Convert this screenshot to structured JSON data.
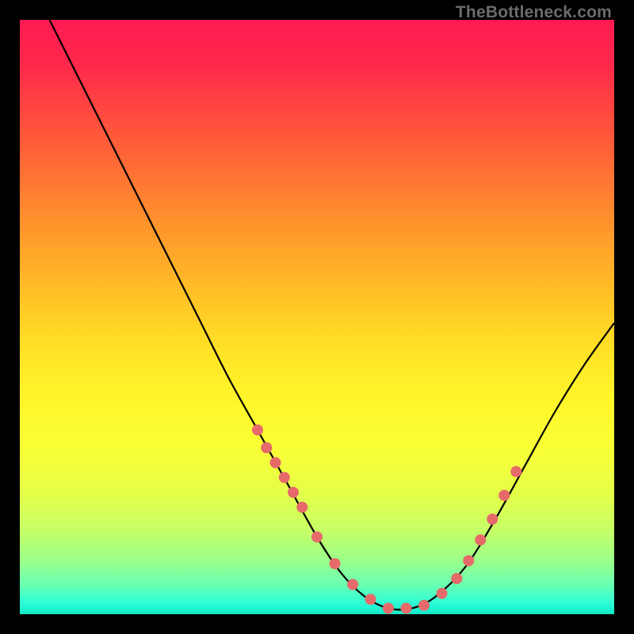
{
  "watermark": "TheBottleneck.com",
  "colors": {
    "background": "#000000",
    "curve_stroke": "#000000",
    "marker_fill": "#e66a6a",
    "gradient_top": "#ff1a52",
    "gradient_bottom": "#12e8c8"
  },
  "chart_data": {
    "type": "line",
    "title": "",
    "xlabel": "",
    "ylabel": "",
    "xlim": [
      0,
      100
    ],
    "ylim": [
      0,
      100
    ],
    "grid": false,
    "background_gradient": "vertical red→yellow→green",
    "note": "Axes are unlabeled; values estimated from pixel positions on a 0–100 normalized grid. Lower y = lower on screen (closer to green/optimal).",
    "series": [
      {
        "name": "bottleneck-curve",
        "x": [
          5,
          10,
          15,
          20,
          25,
          30,
          35,
          40,
          45,
          50,
          54,
          58,
          62,
          66,
          70,
          75,
          80,
          85,
          90,
          95,
          100
        ],
        "y": [
          100,
          90,
          80,
          70,
          60,
          50,
          40,
          31,
          22,
          13,
          7,
          3,
          1,
          1,
          3,
          8,
          16,
          25,
          34,
          42,
          49
        ]
      }
    ],
    "markers": {
      "name": "threshold-dots",
      "x": [
        40,
        41.5,
        43,
        44.5,
        46,
        47.5,
        50,
        53,
        56,
        59,
        62,
        65,
        68,
        71,
        73.5,
        75.5,
        77.5,
        79.5,
        81.5,
        83.5
      ],
      "y": [
        31,
        28,
        25.5,
        23,
        20.5,
        18,
        13,
        8.5,
        5,
        2.5,
        1,
        1,
        1.5,
        3.5,
        6,
        9,
        12.5,
        16,
        20,
        24
      ]
    }
  }
}
